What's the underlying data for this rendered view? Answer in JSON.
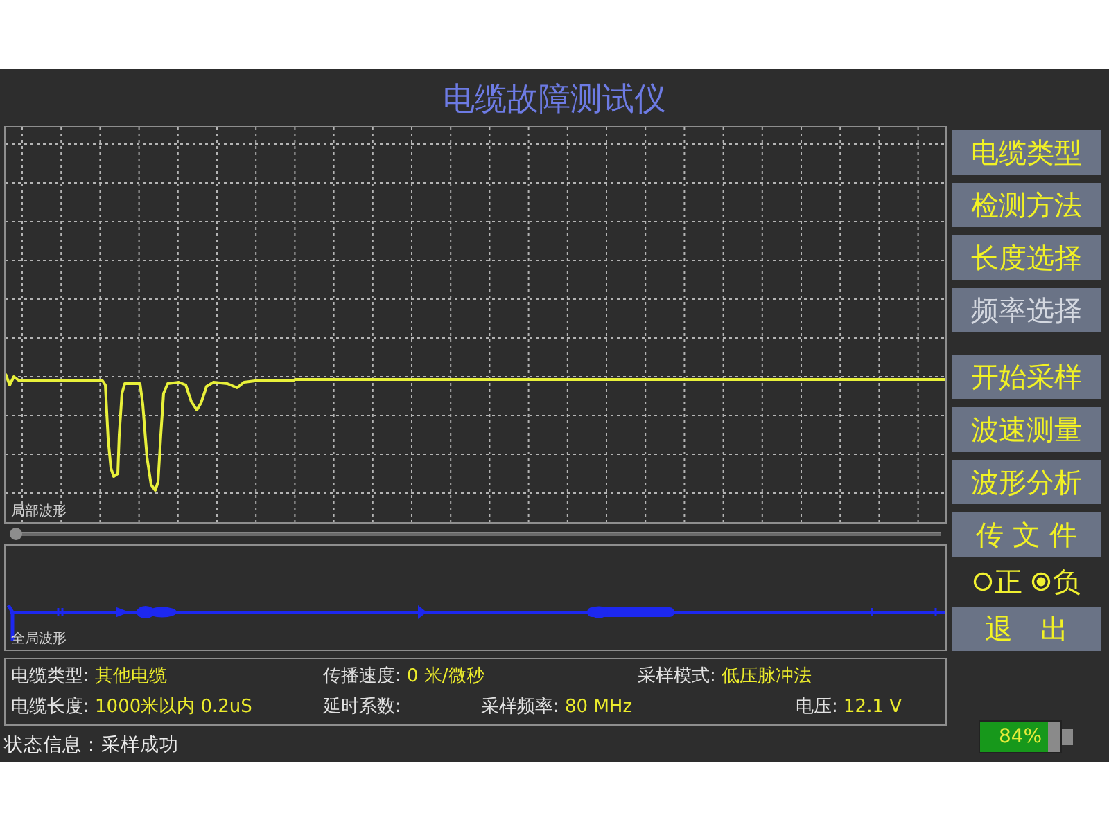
{
  "title": "电缆故障测试仪",
  "local_waveform": {
    "label": "局部波形"
  },
  "position_slider": {
    "level": 0
  },
  "global_waveform": {
    "label": "全局波形"
  },
  "info": [
    [
      {
        "label": "电缆类型:",
        "value": "其他电缆"
      },
      {
        "label": "传播速度:",
        "value": "0 米/微秒"
      },
      {
        "label": "采样模式:",
        "value": "低压脉冲法"
      }
    ],
    [
      {
        "label": "电缆长度:",
        "value": "1000米以内 0.2uS"
      },
      {
        "label": "延时系数:"
      },
      {
        "label": "采样频率:",
        "value": "80 MHz"
      },
      {
        "label": "电压:",
        "value": "12.1 V"
      }
    ]
  ],
  "status": "状态信息：采样成功",
  "side_panel": {
    "settings_buttons": [
      {
        "label": "电缆类型",
        "disabled": false
      },
      {
        "label": "检测方法",
        "disabled": false
      },
      {
        "label": "长度选择",
        "disabled": false
      },
      {
        "label": "频率选择",
        "disabled": true
      }
    ],
    "action_buttons": [
      {
        "label": "开始采样",
        "disabled": false
      },
      {
        "label": "波速测量",
        "disabled": false
      },
      {
        "label": "波形分析",
        "disabled": false
      },
      {
        "label": "传 文 件",
        "disabled": false
      }
    ],
    "polarity": [
      {
        "label": "正",
        "selected": false
      },
      {
        "label": "负",
        "selected": true
      }
    ],
    "exit_button": {
      "label": "退　出"
    }
  },
  "battery": {
    "reading": "84%",
    "level": 0.84
  }
}
